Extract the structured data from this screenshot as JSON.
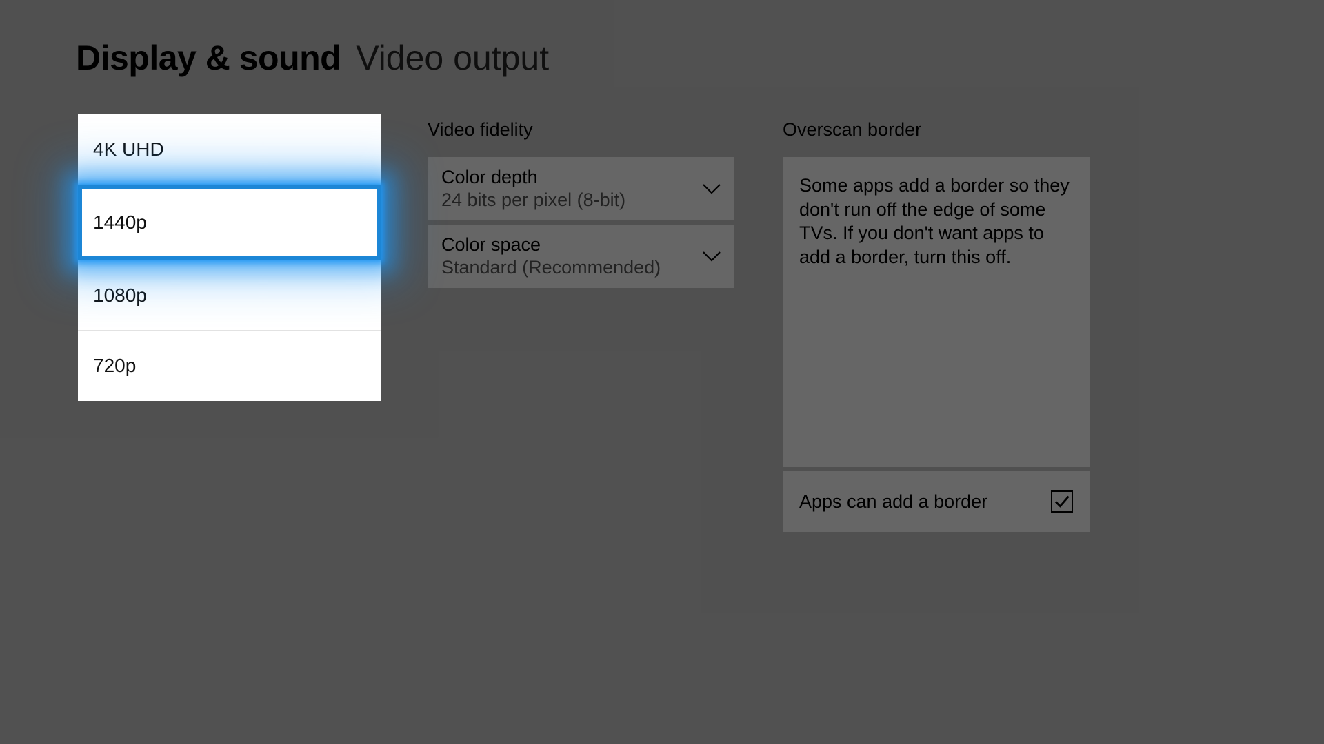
{
  "header": {
    "title": "Display & sound",
    "subtitle": "Video output"
  },
  "resolution": {
    "options": [
      "4K UHD",
      "1440p",
      "1080p",
      "720p"
    ],
    "selected_index": 1
  },
  "fidelity": {
    "section_label": "Video fidelity",
    "color_depth": {
      "label": "Color depth",
      "value": "24 bits per pixel (8-bit)"
    },
    "color_space": {
      "label": "Color space",
      "value": "Standard (Recommended)"
    }
  },
  "overscan": {
    "section_label": "Overscan border",
    "description": "Some apps add a border so they don't run off the edge of some TVs. If you don't want apps to add a border, turn this off.",
    "checkbox_label": "Apps can add a border",
    "checked": true
  }
}
